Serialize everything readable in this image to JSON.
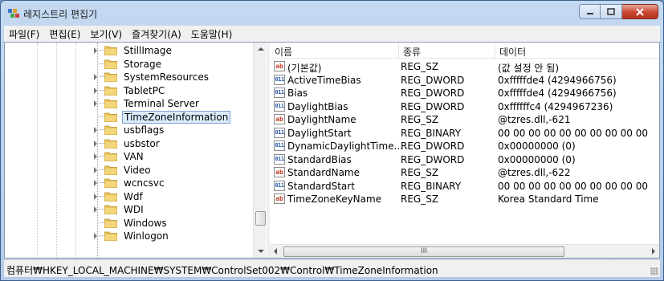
{
  "window": {
    "title": "레지스트리 편집기"
  },
  "menu": [
    "파일(F)",
    "편집(E)",
    "보기(V)",
    "즐겨찾기(A)",
    "도움말(H)"
  ],
  "tree": {
    "items": [
      {
        "label": "StillImage",
        "expandable": true,
        "selected": false
      },
      {
        "label": "Storage",
        "expandable": false,
        "selected": false
      },
      {
        "label": "SystemResources",
        "expandable": true,
        "selected": false
      },
      {
        "label": "TabletPC",
        "expandable": true,
        "selected": false
      },
      {
        "label": "Terminal Server",
        "expandable": true,
        "selected": false
      },
      {
        "label": "TimeZoneInformation",
        "expandable": false,
        "selected": true
      },
      {
        "label": "usbflags",
        "expandable": true,
        "selected": false
      },
      {
        "label": "usbstor",
        "expandable": true,
        "selected": false
      },
      {
        "label": "VAN",
        "expandable": true,
        "selected": false
      },
      {
        "label": "Video",
        "expandable": true,
        "selected": false
      },
      {
        "label": "wcncsvc",
        "expandable": true,
        "selected": false
      },
      {
        "label": "Wdf",
        "expandable": true,
        "selected": false
      },
      {
        "label": "WDI",
        "expandable": true,
        "selected": false
      },
      {
        "label": "Windows",
        "expandable": false,
        "selected": false
      },
      {
        "label": "Winlogon",
        "expandable": true,
        "selected": false
      }
    ]
  },
  "list": {
    "headers": {
      "name": "이름",
      "type": "종류",
      "data": "데이터"
    },
    "rows": [
      {
        "icon": "string-value-icon",
        "name": "(기본값)",
        "type": "REG_SZ",
        "data": "(값 설정 안 됨)"
      },
      {
        "icon": "binary-value-icon",
        "name": "ActiveTimeBias",
        "type": "REG_DWORD",
        "data": "0xfffffde4 (4294966756)"
      },
      {
        "icon": "binary-value-icon",
        "name": "Bias",
        "type": "REG_DWORD",
        "data": "0xfffffde4 (4294966756)"
      },
      {
        "icon": "binary-value-icon",
        "name": "DaylightBias",
        "type": "REG_DWORD",
        "data": "0xffffffc4 (4294967236)"
      },
      {
        "icon": "string-value-icon",
        "name": "DaylightName",
        "type": "REG_SZ",
        "data": "@tzres.dll,-621"
      },
      {
        "icon": "binary-value-icon",
        "name": "DaylightStart",
        "type": "REG_BINARY",
        "data": "00 00 00 00 00 00 00 00 00 00"
      },
      {
        "icon": "binary-value-icon",
        "name": "DynamicDaylightTime...",
        "type": "REG_DWORD",
        "data": "0x00000000 (0)"
      },
      {
        "icon": "binary-value-icon",
        "name": "StandardBias",
        "type": "REG_DWORD",
        "data": "0x00000000 (0)"
      },
      {
        "icon": "string-value-icon",
        "name": "StandardName",
        "type": "REG_SZ",
        "data": "@tzres.dll,-622"
      },
      {
        "icon": "binary-value-icon",
        "name": "StandardStart",
        "type": "REG_BINARY",
        "data": "00 00 00 00 00 00 00 00 00 00"
      },
      {
        "icon": "string-value-icon",
        "name": "TimeZoneKeyName",
        "type": "REG_SZ",
        "data": "Korea Standard Time"
      }
    ],
    "hscroll_grip": "III"
  },
  "status": {
    "path": "컴퓨터₩HKEY_LOCAL_MACHINE₩SYSTEM₩ControlSet002₩Control₩TimeZoneInformation"
  },
  "colors": {
    "title_bar": "#c4d9f1",
    "close_button": "#c9452f",
    "folder": "#e8c25a",
    "selection": "#dcebfc"
  }
}
